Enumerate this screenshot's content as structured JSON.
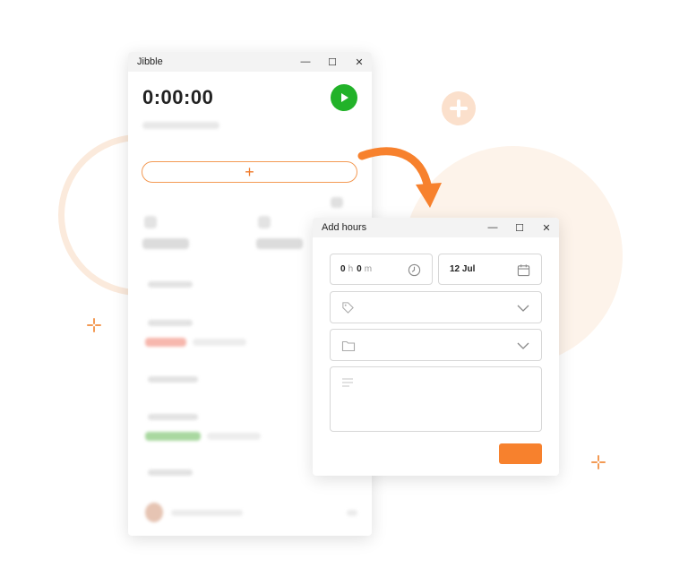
{
  "jibble_window": {
    "title": "Jibble",
    "timer": "0:00:00",
    "add_symbol": "+",
    "window_controls": {
      "minimize": "—",
      "maximize": "☐",
      "close": "✕"
    }
  },
  "add_hours_window": {
    "title": "Add hours",
    "duration": {
      "hours": "0",
      "hours_unit": "h",
      "minutes": "0",
      "minutes_unit": "m"
    },
    "date": "12 Jul",
    "icons": {
      "duration": "clock-icon",
      "date": "calendar-icon",
      "activity": "tag-icon",
      "project": "folder-icon",
      "notes": "notes-lines-icon",
      "dropdown": "chevron-down-icon"
    },
    "window_controls": {
      "minimize": "—",
      "maximize": "☐",
      "close": "✕"
    }
  },
  "colors": {
    "accent": "#f7812d",
    "play": "#22b229",
    "background_blob": "#fdf3ea"
  }
}
